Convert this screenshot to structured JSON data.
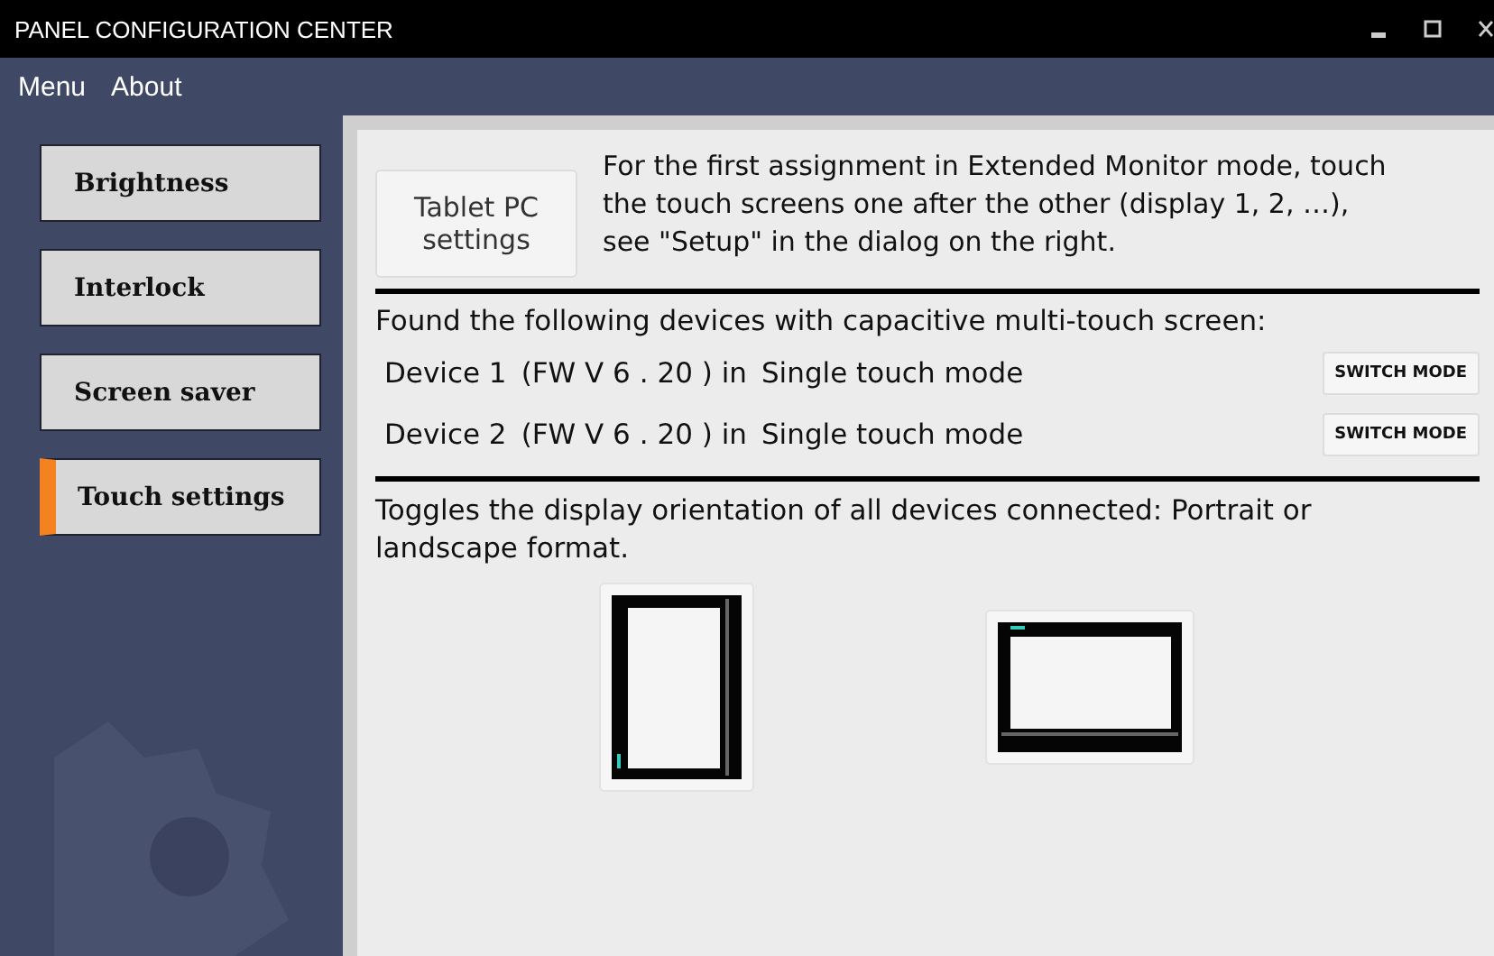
{
  "window": {
    "title": "PANEL CONFIGURATION CENTER"
  },
  "menu": [
    "Menu",
    "About"
  ],
  "sidebar": {
    "items": [
      {
        "label": "Brightness",
        "selected": false
      },
      {
        "label": "Interlock",
        "selected": false
      },
      {
        "label": "Screen saver",
        "selected": false
      },
      {
        "label": "Touch settings",
        "selected": true
      }
    ]
  },
  "tablet": {
    "button": "Tablet PC settings",
    "note": "For the first assignment in Extended Monitor mode, touch the touch screens one after the other (display 1, 2, …), see \"Setup\" in the dialog on the right."
  },
  "devices": {
    "heading": "Found the following devices with capacitive multi-touch screen:",
    "rows": [
      {
        "name": "Device 1",
        "firmware": "(FW V 6 . 20 ) in",
        "mode": "Single touch mode",
        "button": "SWITCH MODE"
      },
      {
        "name": "Device 2",
        "firmware": "(FW V 6 . 20 ) in",
        "mode": "Single touch mode",
        "button": "SWITCH MODE"
      }
    ]
  },
  "orientation": {
    "text": "Toggles the display orientation of all devices connected: Portrait or landscape format.",
    "options": [
      {
        "kind": "portrait"
      },
      {
        "kind": "landscape"
      }
    ]
  }
}
